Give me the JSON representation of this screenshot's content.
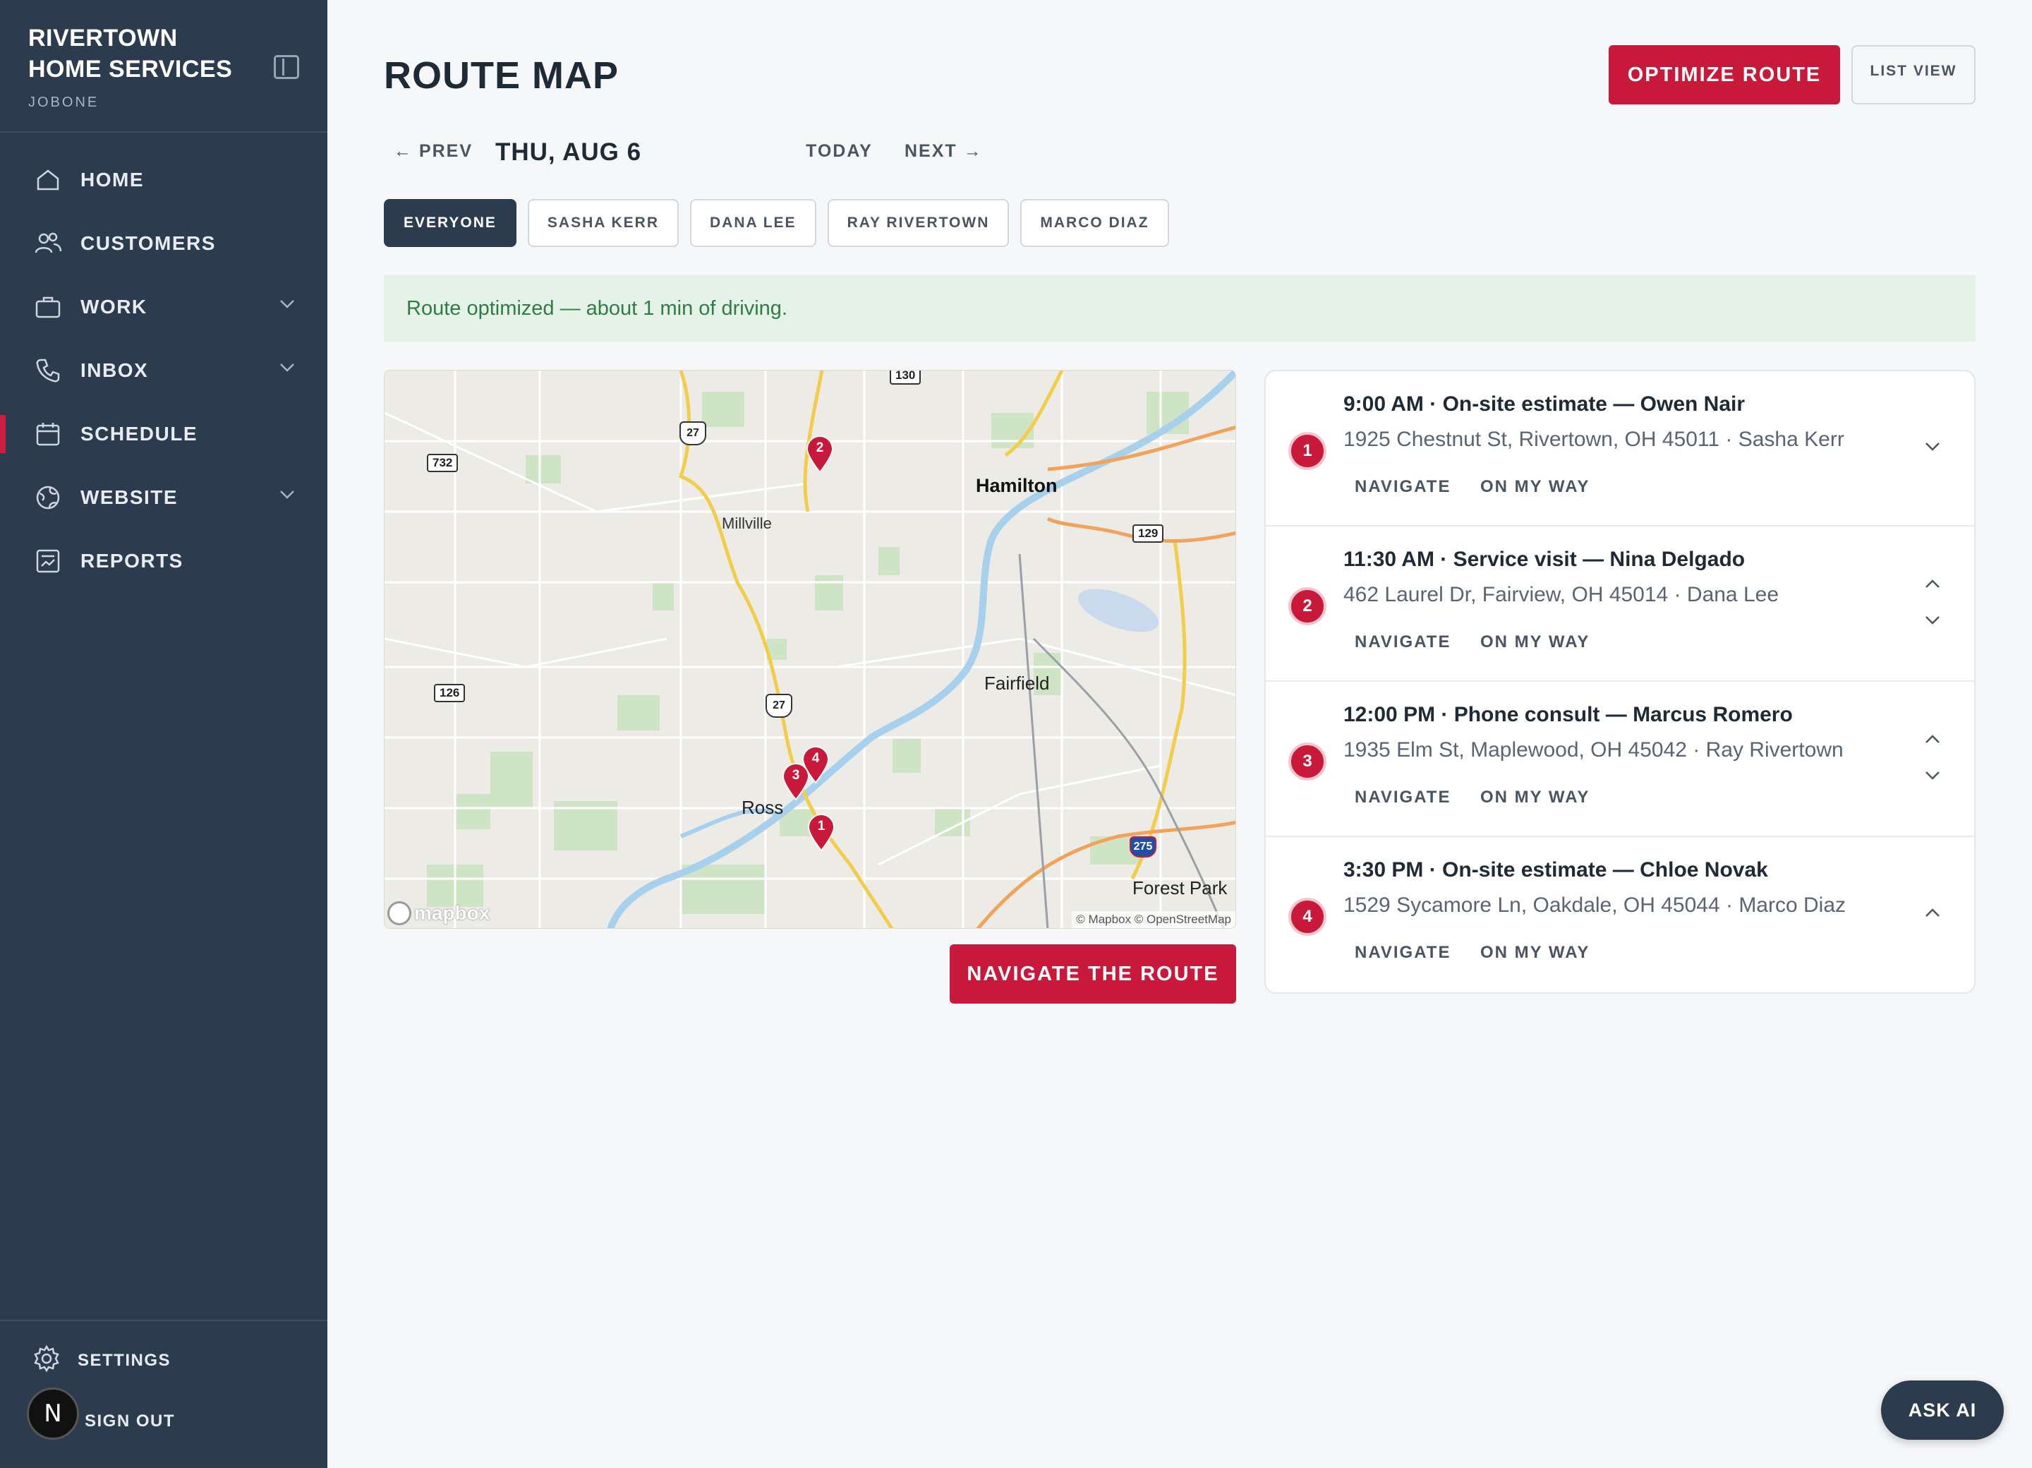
{
  "brand": {
    "name": "RIVERTOWN HOME SERVICES",
    "sub": "JOBONE"
  },
  "sidebar": {
    "items": [
      {
        "label": "HOME",
        "icon": "home-icon"
      },
      {
        "label": "CUSTOMERS",
        "icon": "users-icon"
      },
      {
        "label": "WORK",
        "icon": "briefcase-icon"
      },
      {
        "label": "INBOX",
        "icon": "phone-icon"
      },
      {
        "label": "SCHEDULE",
        "icon": "calendar-icon"
      },
      {
        "label": "WEBSITE",
        "icon": "globe-icon"
      },
      {
        "label": "REPORTS",
        "icon": "report-icon"
      }
    ],
    "settings_label": "SETTINGS",
    "signout_label": "SIGN OUT",
    "avatar_letter": "N"
  },
  "header": {
    "title": "ROUTE MAP",
    "optimize_label": "OPTIMIZE ROUTE",
    "listview_label": "LIST VIEW"
  },
  "datebar": {
    "prev": "← PREV",
    "date": "THU, AUG 6",
    "today": "TODAY",
    "next": "NEXT →"
  },
  "filters": [
    "EVERYONE",
    "SASHA KERR",
    "DANA LEE",
    "RAY RIVERTOWN",
    "MARCO DIAZ"
  ],
  "banner": "Route optimized — about 1 min of driving.",
  "map": {
    "labels": {
      "hamilton": "Hamilton",
      "millville": "Millville",
      "fairfield": "Fairfield",
      "ross": "Ross",
      "forest_park": "Forest Park"
    },
    "shields": {
      "r130": "130",
      "r732": "732",
      "r129": "129",
      "r126": "126",
      "us27a": "27",
      "us27b": "27",
      "i275": "275"
    },
    "mapbox": "mapbox",
    "attribution": "© Mapbox © OpenStreetMap"
  },
  "navigate_route_label": "NAVIGATE THE ROUTE",
  "stops": [
    {
      "num": "1",
      "title": "9:00 AM · On-site estimate — Owen Nair",
      "address": "1925 Chestnut St, Rivertown, OH 45011 · Sasha Kerr",
      "navigate": "NAVIGATE",
      "onmyway": "ON MY WAY"
    },
    {
      "num": "2",
      "title": "11:30 AM · Service visit — Nina Delgado",
      "address": "462 Laurel Dr, Fairview, OH 45014 · Dana Lee",
      "navigate": "NAVIGATE",
      "onmyway": "ON MY WAY"
    },
    {
      "num": "3",
      "title": "12:00 PM · Phone consult — Marcus Romero",
      "address": "1935 Elm St, Maplewood, OH 45042 · Ray Rivertown",
      "navigate": "NAVIGATE",
      "onmyway": "ON MY WAY"
    },
    {
      "num": "4",
      "title": "3:30 PM · On-site estimate — Chloe Novak",
      "address": "1529 Sycamore Ln, Oakdale, OH 45044 · Marco Diaz",
      "navigate": "NAVIGATE",
      "onmyway": "ON MY WAY"
    }
  ],
  "ask_ai": "ASK AI",
  "colors": {
    "sidebar": "#2d3b4f",
    "accent": "#c8193b",
    "banner_bg": "#e4f2e7",
    "banner_text": "#2e7d43"
  }
}
